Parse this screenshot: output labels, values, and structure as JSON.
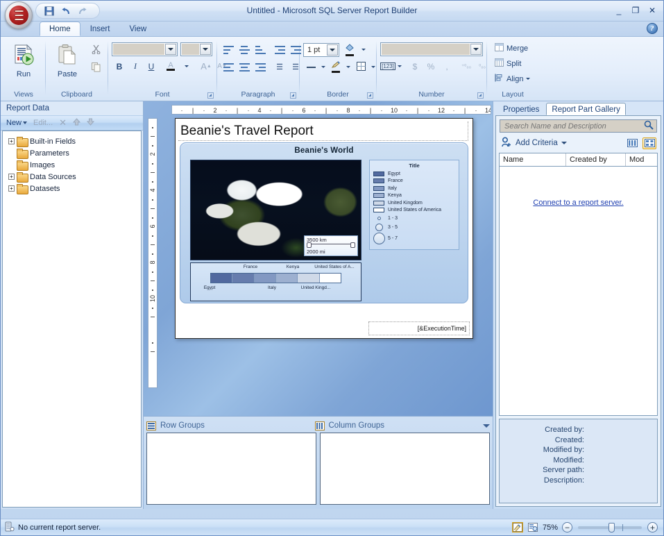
{
  "window": {
    "title": "Untitled - Microsoft SQL Server Report Builder",
    "minimize": "_",
    "maximize": "❐",
    "close": "✕"
  },
  "quick_access": {
    "save": "save-icon",
    "undo": "undo-icon",
    "redo": "redo-icon"
  },
  "tabs": [
    {
      "label": "Home",
      "active": true
    },
    {
      "label": "Insert",
      "active": false
    },
    {
      "label": "View",
      "active": false
    }
  ],
  "help_button": "?",
  "ribbon": {
    "groups": [
      {
        "name": "Views",
        "label": "Views",
        "buttons": [
          {
            "label": "Run",
            "icon": "run-report-icon"
          }
        ]
      },
      {
        "name": "Clipboard",
        "label": "Clipboard",
        "buttons": [
          {
            "label": "Paste",
            "icon": "paste-icon"
          },
          {
            "label": "",
            "icon": "cut-icon"
          },
          {
            "label": "",
            "icon": "copy-icon"
          }
        ]
      },
      {
        "name": "Font",
        "label": "Font",
        "font_family_value": "",
        "font_size_value": "",
        "bold": "B",
        "italic": "I",
        "underline": "U",
        "font_color": "A",
        "grow_font": "A",
        "shrink_font": "A"
      },
      {
        "name": "Paragraph",
        "label": "Paragraph"
      },
      {
        "name": "Border",
        "label": "Border",
        "width_value": "1 pt"
      },
      {
        "name": "Number",
        "label": "Number",
        "format_value": "",
        "currency": "$",
        "percent": "%",
        "comma": ",",
        "number_style": "[123]"
      },
      {
        "name": "Layout",
        "label": "Layout",
        "merge": "Merge",
        "split": "Split",
        "align": "Align"
      }
    ]
  },
  "report_data": {
    "title": "Report Data",
    "toolbar": {
      "new": "New",
      "edit": "Edit...",
      "delete": "✕",
      "move_up": "move-up-icon",
      "move_down": "move-down-icon"
    },
    "tree": [
      {
        "label": "Built-in Fields",
        "expandable": true
      },
      {
        "label": "Parameters",
        "expandable": false
      },
      {
        "label": "Images",
        "expandable": false
      },
      {
        "label": "Data Sources",
        "expandable": true
      },
      {
        "label": "Datasets",
        "expandable": true
      }
    ]
  },
  "design": {
    "ruler_h": [
      "2",
      "4",
      "6",
      "8",
      "10",
      "12",
      "14"
    ],
    "ruler_v": [
      "2",
      "4",
      "6",
      "8",
      "10"
    ],
    "report_title": "Beanie's Travel Report",
    "footer_text": "[&ExecutionTime]",
    "map": {
      "title": "Beanie's World",
      "scale_km": "3500 km",
      "scale_mi": "2000 mi",
      "legend_title": "Title",
      "legend_items": [
        {
          "label": "Egypt",
          "color": "#51699f"
        },
        {
          "label": "France",
          "color": "#667cad"
        },
        {
          "label": "Italy",
          "color": "#8298c2"
        },
        {
          "label": "Kenya",
          "color": "#9db0d0"
        },
        {
          "label": "United Kingdom",
          "color": "#cfd9e8"
        },
        {
          "label": "United States of America",
          "color": "#ffffff"
        }
      ],
      "legend_bubbles": [
        {
          "label": "1 - 3",
          "size": 5
        },
        {
          "label": "3 - 5",
          "size": 11
        },
        {
          "label": "5 - 7",
          "size": 17
        }
      ],
      "color_scale": {
        "labels_top": [
          "France",
          "Kenya",
          "United States of A..."
        ],
        "labels_bottom": [
          "Egypt",
          "Italy",
          "United Kingd..."
        ],
        "swatches": [
          "#51699f",
          "#667cad",
          "#8298c2",
          "#9db0d0",
          "#cfd9e8",
          "#ffffff"
        ]
      }
    }
  },
  "groups_pane": {
    "row_groups": "Row Groups",
    "column_groups": "Column Groups"
  },
  "gallery": {
    "tabs": [
      {
        "label": "Properties",
        "active": false
      },
      {
        "label": "Report Part Gallery",
        "active": true
      }
    ],
    "search_placeholder": "Search Name and Description",
    "search_value": "",
    "search_icon": "search-icon",
    "add_criteria": "Add Criteria",
    "view_list_icon": "list-view-icon",
    "view_tile_icon": "tile-view-icon",
    "columns": [
      "Name",
      "Created by",
      "Mod"
    ],
    "empty_link": "Connect to a report server.",
    "meta": [
      "Created by:",
      "Created:",
      "Modified by:",
      "Modified:",
      "Server path:",
      "Description:"
    ]
  },
  "statusbar": {
    "message": "No current report server.",
    "server_icon": "server-icon",
    "design_icon": "design-view-icon",
    "preview_icon": "preview-view-icon",
    "zoom_level": "75%",
    "zoom_out": "−",
    "zoom_in": "+"
  }
}
